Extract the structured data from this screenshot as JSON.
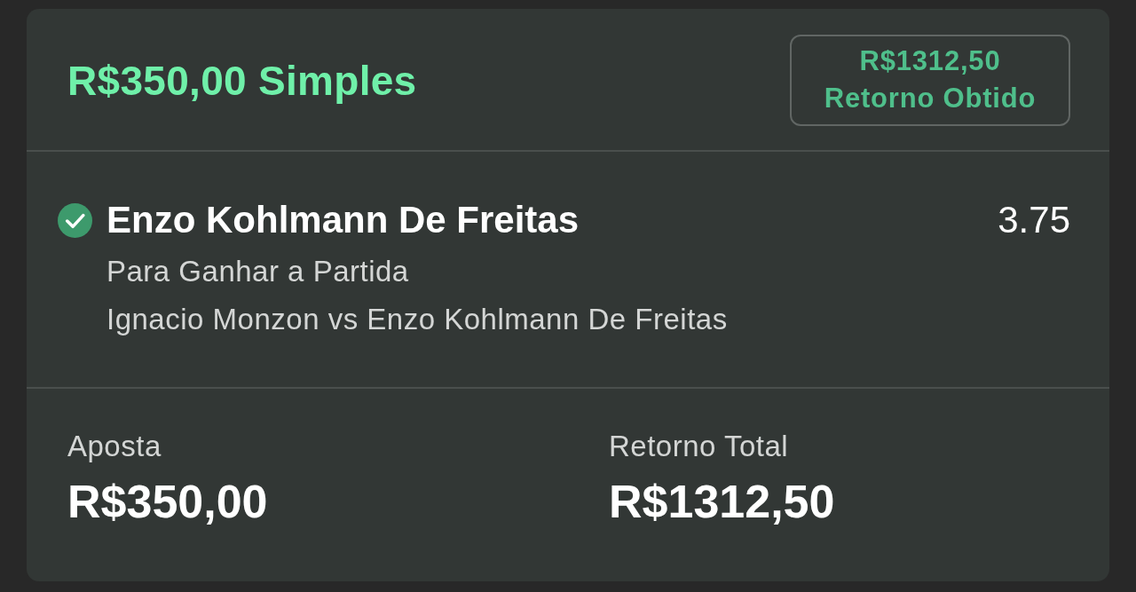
{
  "bet": {
    "title": "R$350,00 Simples",
    "return_badge": {
      "amount": "R$1312,50",
      "label": "Retorno Obtido"
    }
  },
  "selection": {
    "won": true,
    "name": "Enzo Kohlmann De Freitas",
    "odds": "3.75",
    "market": "Para Ganhar a Partida",
    "event": "Ignacio Monzon vs Enzo Kohlmann De Freitas"
  },
  "summary": [
    {
      "label": "Aposta",
      "value": "R$350,00"
    },
    {
      "label": "Retorno Total",
      "value": "R$1312,50"
    }
  ]
}
